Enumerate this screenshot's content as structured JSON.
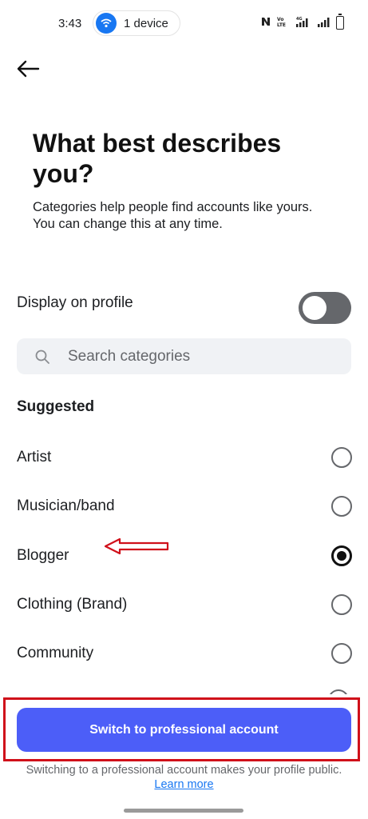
{
  "status_bar": {
    "time": "3:43",
    "device_label": "1 device",
    "icons": [
      "nfc-icon",
      "volte-icon",
      "signal-4g-icon",
      "signal-icon",
      "battery-icon"
    ],
    "network_text": "4G"
  },
  "header": {
    "back_icon": "arrow-left-icon",
    "title": "What best describes you?",
    "subtitle": "Categories help people find accounts like yours. You can change this at any time."
  },
  "display_toggle": {
    "label": "Display on profile",
    "on": false
  },
  "search": {
    "placeholder": "Search categories",
    "value": ""
  },
  "section_title": "Suggested",
  "categories": [
    {
      "label": "Artist",
      "selected": false
    },
    {
      "label": "Musician/band",
      "selected": false
    },
    {
      "label": "Blogger",
      "selected": true
    },
    {
      "label": "Clothing (Brand)",
      "selected": false
    },
    {
      "label": "Community",
      "selected": false
    }
  ],
  "cta": {
    "label": "Switch to professional account"
  },
  "footer": {
    "note": "Switching to a professional account makes your profile public.",
    "link": "Learn more"
  },
  "colors": {
    "accent": "#4c5ef8",
    "annotation_red": "#d0101a",
    "link": "#1877f2"
  }
}
